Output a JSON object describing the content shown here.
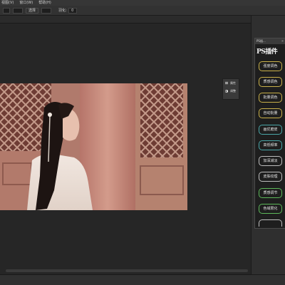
{
  "menubar": {
    "items": [
      "视图(V)",
      "窗口(W)",
      "帮助(H)"
    ]
  },
  "optionsbar": {
    "button_label": "选择",
    "field_label": "羽化:",
    "value": "0"
  },
  "mini_panel": {
    "items": [
      {
        "label": "属性",
        "icon": "properties-icon"
      },
      {
        "label": "调整",
        "icon": "adjustments-icon"
      }
    ]
  },
  "panel": {
    "tab_label": "PS插...",
    "close_glyph": "»",
    "logo_text": "PS插件",
    "buttons": [
      {
        "label": "强度调色",
        "color": "#c9b14a"
      },
      {
        "label": "质感调色",
        "color": "#c9b14a"
      },
      {
        "label": "批量调色",
        "color": "#c9b14a"
      },
      {
        "label": "自动批量",
        "color": "#c9b14a"
      },
      {
        "label": "画优磨皮",
        "color": "#4aa6a8"
      },
      {
        "label": "高低频率",
        "color": "#4aa6a8"
      },
      {
        "label": "加深减淡",
        "color": "#bdbdbd"
      },
      {
        "label": "皮肤纹理",
        "color": "#bdbdbd"
      },
      {
        "label": "质感调节",
        "color": "#5db85a"
      },
      {
        "label": "色域限化",
        "color": "#5db85a"
      }
    ]
  }
}
